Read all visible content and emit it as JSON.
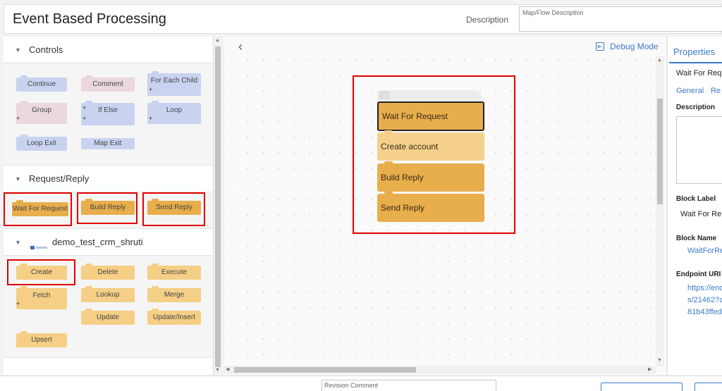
{
  "header": {
    "title": "Event Based Processing",
    "description_label": "Description",
    "description_placeholder": "Map/Flow Description"
  },
  "palette": {
    "controls": {
      "title": "Controls",
      "blocks": [
        "Continue",
        "Comment",
        "For Each Child",
        "Group",
        "If Else",
        "Loop",
        "Loop Exit",
        "Map Exit"
      ]
    },
    "request_reply": {
      "title": "Request/Reply",
      "blocks": [
        "Wait For Request",
        "Build Reply",
        "Send Reply"
      ]
    },
    "connector": {
      "title": "demo_test_crm_shruti",
      "blocks": [
        "Create",
        "Delete",
        "Execute",
        "Fetch",
        "Lookup",
        "Merge",
        "Update",
        "Update/Insert",
        "Upsert"
      ]
    }
  },
  "canvas": {
    "debug_mode": "Debug Mode",
    "flow_blocks": [
      "Wait For Request",
      "Create account",
      "Build Reply",
      "Send Reply"
    ]
  },
  "properties": {
    "tab_label": "Properties",
    "block_title": "Wait For Req",
    "tabs": [
      "General",
      "Re"
    ],
    "description_label": "Description",
    "block_label_title": "Block Label",
    "block_label_value": "Wait For Re",
    "block_name_title": "Block Name",
    "block_name_value": "WaitForRe",
    "endpoint_title": "Endpoint URI",
    "endpoint_lines": [
      "https://end",
      "s/21462?a",
      "81b43ffed"
    ]
  },
  "footer": {
    "revision_comment_placeholder": "Revision Comment"
  },
  "colors": {
    "accent": "#3a7bc8",
    "control_block": "#c9d3f0",
    "request_block": "#e8ae4c",
    "connector_block": "#f4cf85",
    "highlight": "#e00000"
  }
}
